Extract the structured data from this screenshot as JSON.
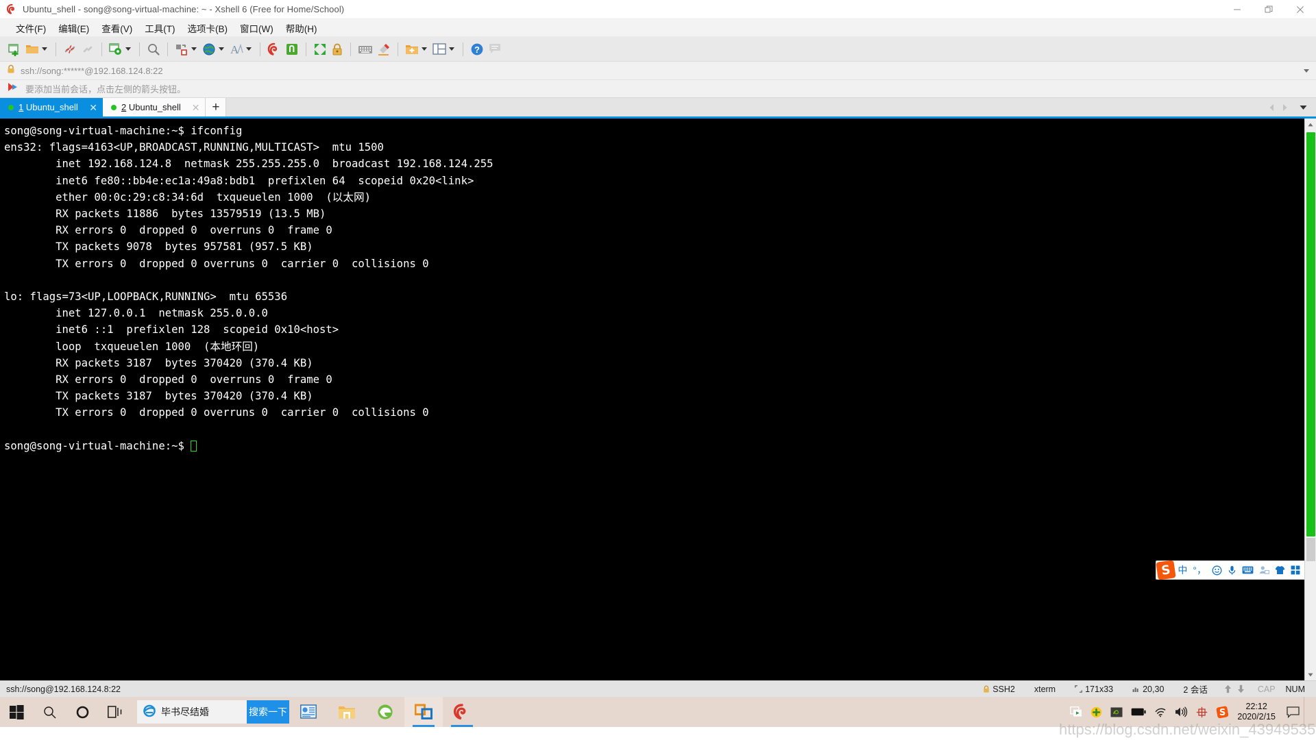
{
  "window": {
    "title": "Ubuntu_shell - song@song-virtual-machine: ~ - Xshell 6 (Free for Home/School)",
    "app_icon": "xshell-logo-icon",
    "minimize_label": "—",
    "restore_label": "❐",
    "close_label": "✕"
  },
  "menu": {
    "items": [
      {
        "label": "文件(F)",
        "name": "menu-file"
      },
      {
        "label": "编辑(E)",
        "name": "menu-edit"
      },
      {
        "label": "查看(V)",
        "name": "menu-view"
      },
      {
        "label": "工具(T)",
        "name": "menu-tools"
      },
      {
        "label": "选项卡(B)",
        "name": "menu-tabs"
      },
      {
        "label": "窗口(W)",
        "name": "menu-window"
      },
      {
        "label": "帮助(H)",
        "name": "menu-help"
      }
    ]
  },
  "toolbar": {
    "items": [
      "new-session-icon",
      "open-folder-icon",
      "disconnect-icon",
      "reconnect-icon",
      "session-properties-icon",
      "find-icon",
      "transfer-file-icon",
      "globe-icon",
      "font-icon",
      "xshell-icon",
      "green-app-icon",
      "fullscreen-icon",
      "lock-icon",
      "keyboard-icon",
      "highlight-icon",
      "add-folder-icon",
      "layout-icon",
      "help-icon",
      "chat-icon"
    ]
  },
  "address": {
    "lock_icon": "lock-icon",
    "value": "ssh://song:******@192.168.124.8:22",
    "dropdown_icon": "chevron-down-icon"
  },
  "hint": {
    "icon": "red-arrow-icon",
    "text": "要添加当前会话，点击左侧的箭头按钮。"
  },
  "tabs": {
    "items": [
      {
        "num": "1",
        "label": "Ubuntu_shell",
        "active": true,
        "close": "✕"
      },
      {
        "num": "2",
        "label": "Ubuntu_shell",
        "active": false,
        "close": "✕"
      }
    ],
    "add_label": "+",
    "prev_icon": "chevron-left-icon",
    "next_icon": "chevron-right-icon",
    "menu_icon": "chevron-down-icon"
  },
  "terminal": {
    "lines": [
      "song@song-virtual-machine:~$ ifconfig",
      "ens32: flags=4163<UP,BROADCAST,RUNNING,MULTICAST>  mtu 1500",
      "        inet 192.168.124.8  netmask 255.255.255.0  broadcast 192.168.124.255",
      "        inet6 fe80::bb4e:ec1a:49a8:bdb1  prefixlen 64  scopeid 0x20<link>",
      "        ether 00:0c:29:c8:34:6d  txqueuelen 1000  (以太网)",
      "        RX packets 11886  bytes 13579519 (13.5 MB)",
      "        RX errors 0  dropped 0  overruns 0  frame 0",
      "        TX packets 9078  bytes 957581 (957.5 KB)",
      "        TX errors 0  dropped 0 overruns 0  carrier 0  collisions 0",
      "",
      "lo: flags=73<UP,LOOPBACK,RUNNING>  mtu 65536",
      "        inet 127.0.0.1  netmask 255.0.0.0",
      "        inet6 ::1  prefixlen 128  scopeid 0x10<host>",
      "        loop  txqueuelen 1000  (本地环回)",
      "        RX packets 3187  bytes 370420 (370.4 KB)",
      "        RX errors 0  dropped 0  overruns 0  frame 0",
      "        TX packets 3187  bytes 370420 (370.4 KB)",
      "        TX errors 0  dropped 0 overruns 0  carrier 0  collisions 0",
      "",
      "song@song-virtual-machine:~$ "
    ],
    "bg_color": "#000000",
    "fg_color": "#ffffff",
    "cursor_color": "#19e019"
  },
  "ime": {
    "logo": "S",
    "items": [
      "中",
      "°，",
      "smiley-icon",
      "microphone-icon",
      "keyboard-icon",
      "user-icon",
      "skin-icon",
      "apps-icon"
    ]
  },
  "statusbar": {
    "left": "ssh://song@192.168.124.8:22",
    "protocol_icon": "lock-icon",
    "protocol": "SSH2",
    "terminal_type": "xterm",
    "size_icon": "size-icon",
    "size": "171x33",
    "cursor_icon": "cursor-icon",
    "cursor_pos": "20,30",
    "sessions": "2 会话",
    "up_icon": "arrow-up-icon",
    "down_icon": "arrow-down-icon",
    "cap": "CAP",
    "num": "NUM"
  },
  "taskbar": {
    "start_icon": "windows-start-icon",
    "search_icon": "search-icon",
    "cortana_icon": "cortana-icon",
    "taskview_icon": "task-view-icon",
    "search_box": {
      "icon": "ie-icon",
      "value": "毕书尽结婚",
      "go_label": "搜索一下"
    },
    "apps": [
      {
        "icon": "presentation-icon",
        "name": "taskbar-app-wps"
      },
      {
        "icon": "folder-icon",
        "name": "taskbar-app-explorer"
      },
      {
        "icon": "edge-icon",
        "name": "taskbar-app-edge"
      },
      {
        "icon": "vmware-icon",
        "name": "taskbar-app-vmware"
      },
      {
        "icon": "xshell-icon",
        "name": "taskbar-app-xshell"
      }
    ],
    "tray": [
      "screencast-icon",
      "update-icon",
      "nvidia-icon",
      "battery-icon",
      "wifi-icon",
      "volume-icon",
      "ime-mode-icon",
      "sogou-icon"
    ],
    "clock_time": "22:12",
    "clock_date": "2020/2/15",
    "notifications_icon": "notification-icon"
  },
  "watermark": "https://blog.csdn.net/weixin_43949535"
}
